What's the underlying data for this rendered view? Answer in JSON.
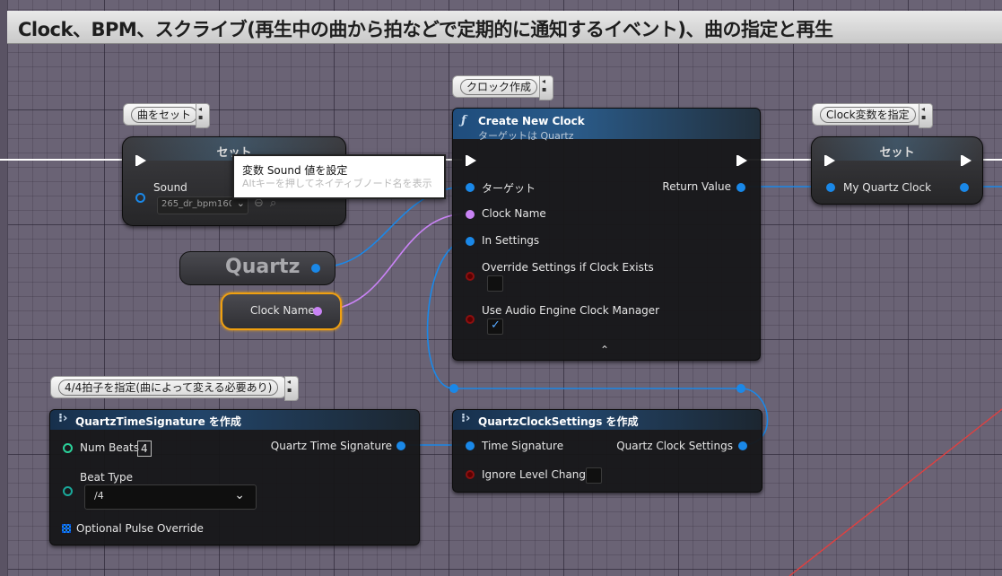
{
  "title": "Clock、BPM、スクライブ(再生中の曲から拍などで定期的に通知するイベント)、曲の指定と再生",
  "comments": {
    "set_song": "曲をセット",
    "create_clock": "クロック作成",
    "set_clock_var": "Clock変数を指定",
    "time_sig": "4/4拍子を指定(曲によって変える必要あり)"
  },
  "set_sound_node": {
    "title": "セット",
    "pin_sound": "Sound",
    "sound_asset": "265_dr_bpm160",
    "tooltip_main": "変数 Sound 値を設定",
    "tooltip_hint": "Altキーを押してネイティブノード名を表示"
  },
  "quartz_node": {
    "label": "Quartz"
  },
  "clock_name_node": {
    "label": "Clock Name"
  },
  "create_clock_node": {
    "title": "Create New Clock",
    "subtitle": "ターゲットは Quartz",
    "pin_target": "ターゲット",
    "pin_clock_name": "Clock Name",
    "pin_in_settings": "In Settings",
    "pin_override": "Override Settings if Clock Exists",
    "pin_use_audio": "Use Audio Engine Clock Manager",
    "pin_return": "Return Value"
  },
  "set_clock_node": {
    "title": "セット",
    "pin_my_clock": "My Quartz Clock"
  },
  "time_sig_node": {
    "title": "QuartzTimeSignature を作成",
    "pin_num_beats": "Num Beats",
    "num_beats_value": "4",
    "pin_beat_type": "Beat Type",
    "beat_type_value": "/4",
    "pin_pulse_override": "Optional Pulse Override",
    "pin_out": "Quartz Time Signature"
  },
  "clock_settings_node": {
    "title": "QuartzClockSettings を作成",
    "pin_time_sig": "Time Signature",
    "pin_ignore_level": "Ignore Level Change",
    "pin_out": "Quartz Clock Settings"
  },
  "colors": {
    "exec": "#ffffff",
    "object_pin": "#1a88e8",
    "name_pin": "#c983f5",
    "bool_pin": "#8c1010",
    "int_pin": "#2bd19a",
    "selection": "#f0a010",
    "wire_red": "#e04040"
  },
  "icons": {
    "function": "function-icon",
    "make_struct": "make-struct-icon",
    "chevron": "chevron-down-icon",
    "expand": "expand-arrow-icon"
  }
}
